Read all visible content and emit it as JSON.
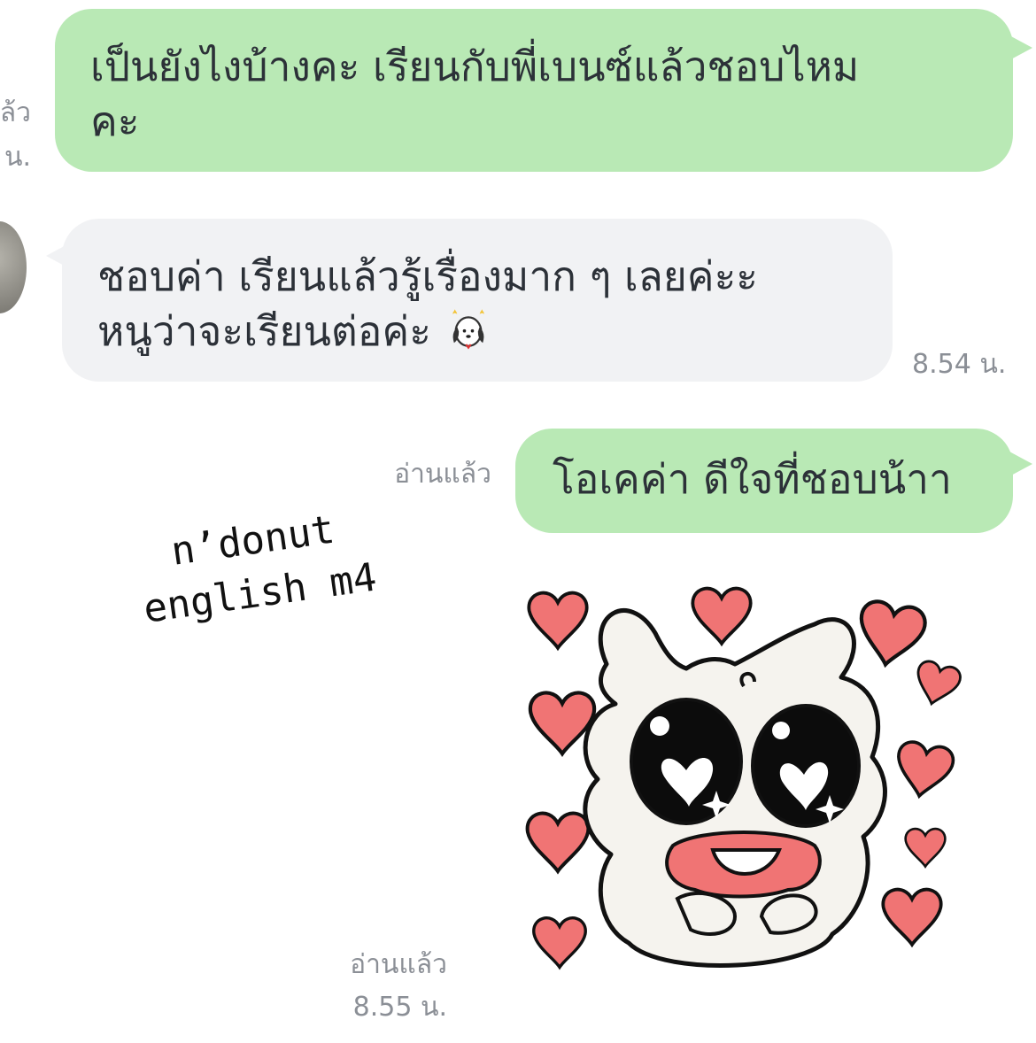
{
  "messages": [
    {
      "id": "m1",
      "direction": "sent",
      "lines": [
        "เป็นยังไงบ้างคะ เรียนกับพี่เบนซ์แล้วชอบไหม",
        "คะ"
      ],
      "read_status_partial": "ล้ว",
      "time_partial": "น."
    },
    {
      "id": "m2",
      "direction": "received",
      "lines": [
        "ชอบค่า เรียนแล้วรู้เรื่องมาก ๆ เลยค่ะะ",
        "หนูว่าจะเรียนต่อค่ะ"
      ],
      "emoji": "puppy-sticker-emoji",
      "time": "8.54 น."
    },
    {
      "id": "m3",
      "direction": "sent",
      "lines": [
        "โอเคค่า ดีใจที่ชอบน้าา"
      ],
      "read_status": "อ่านแล้ว"
    },
    {
      "id": "m4",
      "direction": "sent",
      "type": "sticker",
      "sticker": "heart-eyes-bunny-sticker",
      "read_status": "อ่านแล้ว",
      "time": "8.55 น."
    }
  ],
  "overlay_text": {
    "line1": "n’donut",
    "line2": "english m4"
  },
  "colors": {
    "sent_bubble": "#b9e9b5",
    "received_bubble": "#f1f2f4",
    "meta_text": "#8b8f96",
    "heart": "#f07474"
  }
}
